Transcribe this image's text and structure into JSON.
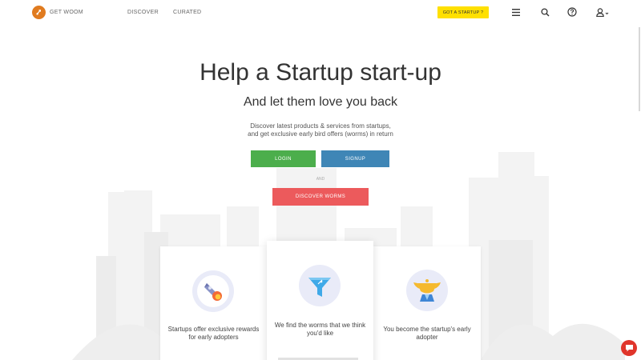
{
  "nav": {
    "brand": "GET WOOM",
    "links": [
      "DISCOVER",
      "CURATED"
    ],
    "cta": "GOT A STARTUP ?",
    "icons": [
      "menu-icon",
      "search-icon",
      "help-icon",
      "user-icon"
    ],
    "cta_color": "#ffe000"
  },
  "hero": {
    "title": "Help a Startup start-up",
    "subtitle": "And let them love you back",
    "desc_line1": "Discover latest products & services from startups,",
    "desc_line2": "and get exclusive early bird offers (worms) in return",
    "login": "LOGIN",
    "signup": "SIGNUP",
    "and": "AND",
    "discover": "DISCOVER WORMS"
  },
  "cards": [
    {
      "icon": "rocket-icon",
      "text": "Startups offer exclusive rewards for early adopters"
    },
    {
      "icon": "funnel-icon",
      "text": "We find the worms that we think you'd like"
    },
    {
      "icon": "trophy-icon",
      "text": "You become the startup's early adopter"
    }
  ],
  "colors": {
    "login": "#4cae4c",
    "signup": "#3f86b6",
    "discover": "#ec5a5c",
    "chat": "#e0352b",
    "logo": "#e07b1f"
  },
  "chat_icon": "chat-bubble-icon"
}
